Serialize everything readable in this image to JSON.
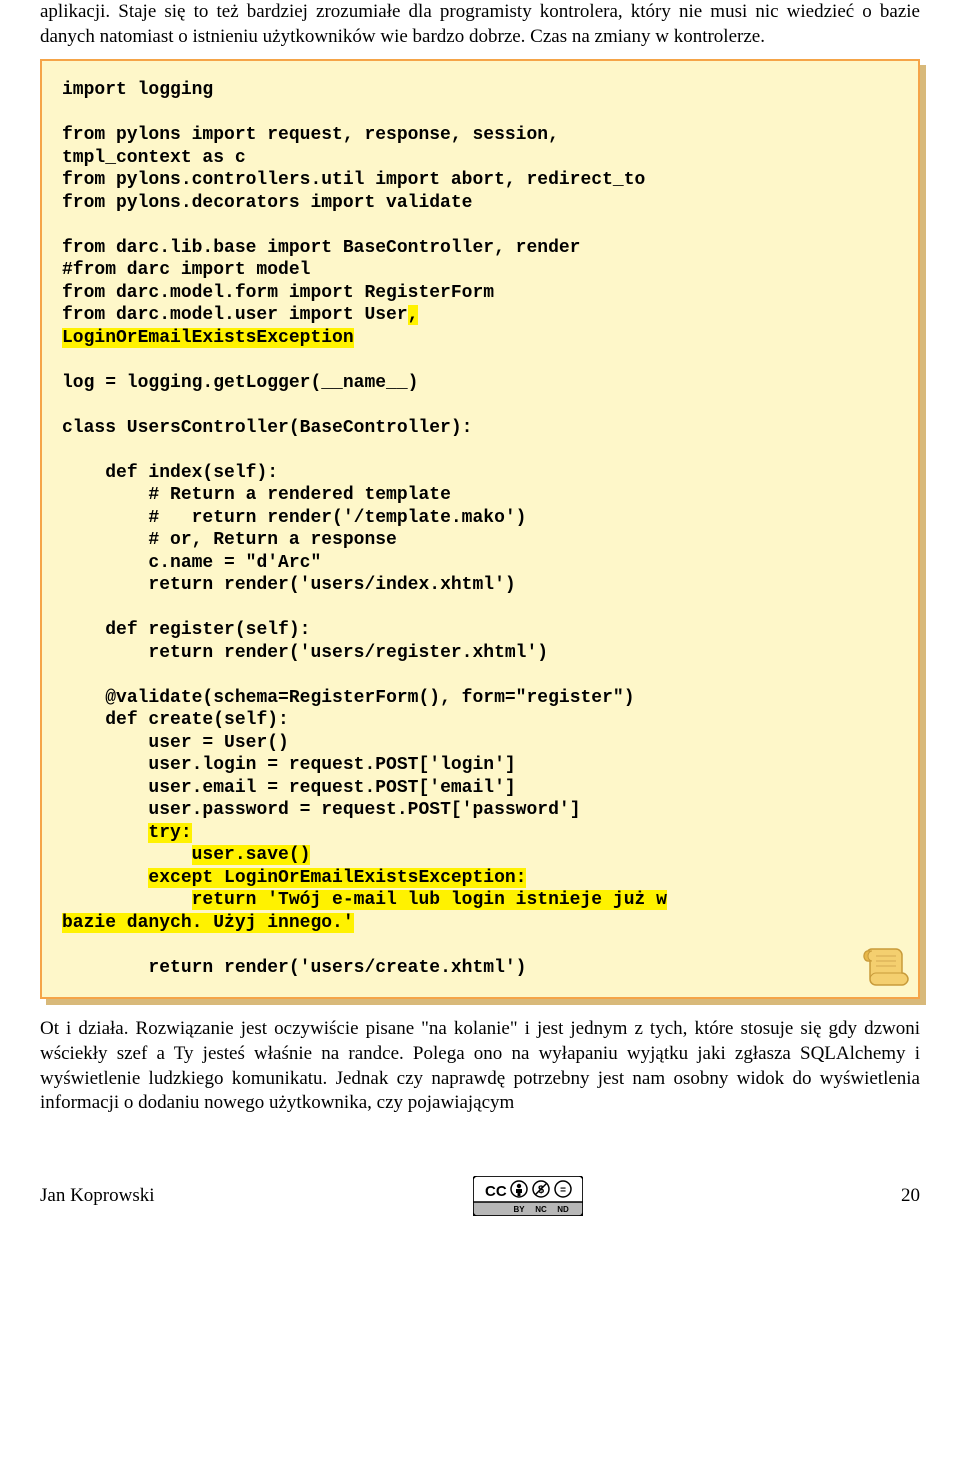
{
  "paragraph_top": "aplikacji. Staje się to też bardziej zrozumiałe dla programisty kontrolera, który nie musi nic wiedzieć o bazie danych natomiast o istnieniu użytkowników wie bardzo dobrze. Czas na zmiany w kontrolerze.",
  "code": {
    "l01": "import logging",
    "l02": "",
    "l03": "from pylons import request, response, session,",
    "l04": "tmpl_context as c",
    "l05": "from pylons.controllers.util import abort, redirect_to",
    "l06": "from pylons.decorators import validate",
    "l07": "",
    "l08": "from darc.lib.base import BaseController, render",
    "l09": "#from darc import model",
    "l10": "from darc.model.form import RegisterForm",
    "l11a": "from darc.model.user import User",
    "l11b": ",",
    "l12": "LoginOrEmailExistsException",
    "l13": "",
    "l14": "log = logging.getLogger(__name__)",
    "l15": "",
    "l16": "class UsersController(BaseController):",
    "l17": "",
    "l18": "    def index(self):",
    "l19": "        # Return a rendered template",
    "l20": "        #   return render('/template.mako')",
    "l21": "        # or, Return a response",
    "l22": "        c.name = \"d'Arc\"",
    "l23": "        return render('users/index.xhtml')",
    "l24": "",
    "l25": "    def register(self):",
    "l26": "        return render('users/register.xhtml')",
    "l27": "",
    "l28": "    @validate(schema=RegisterForm(), form=\"register\")",
    "l29": "    def create(self):",
    "l30": "        user = User()",
    "l31": "        user.login = request.POST['login']",
    "l32": "        user.email = request.POST['email']",
    "l33": "        user.password = request.POST['password']",
    "l34": "        ",
    "l34h": "try:",
    "l35": "            ",
    "l35h": "user.save()",
    "l36": "        ",
    "l36h": "except LoginOrEmailExistsException:",
    "l37": "            ",
    "l37h": "return 'Twój e-mail lub login istnieje już w",
    "l38h": "bazie danych. Użyj innego.'",
    "l39": "",
    "l40": "        return render('users/create.xhtml')"
  },
  "paragraph_bottom": "Ot i działa. Rozwiązanie jest oczywiście pisane \"na kolanie\" i jest jednym z tych, które stosuje się gdy dzwoni wściekły szef a Ty jesteś właśnie na randce. Polega ono na wyłapaniu wyjątku jaki zgłasza SQLAlchemy i wyświetlenie ludzkiego komunikatu. Jednak czy naprawdę potrzebny jest nam osobny widok do wyświetlenia informacji o dodaniu nowego użytkownika, czy pojawiającym",
  "footer": {
    "author": "Jan Koprowski",
    "page": "20",
    "cc_label": "CC BY NC ND"
  }
}
